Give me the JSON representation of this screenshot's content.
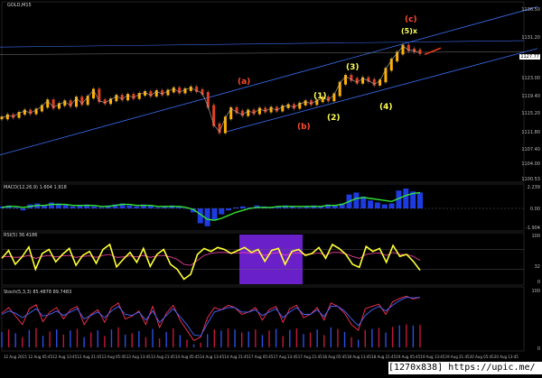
{
  "chart_data": [
    {
      "type": "line",
      "title": "GOLD,M15",
      "ylim": [
        1100.0,
        1138.0
      ],
      "tick_labels_y": [
        "1136.50",
        "1131.20",
        "1127.80",
        "1123.00",
        "1119.40",
        "1115.20",
        "1111.80",
        "1107.40",
        "1104.00",
        "1100.53"
      ],
      "current_price": "1127.77",
      "wave_labels": [
        {
          "text": "(c)",
          "color": "#ff4d2e"
        },
        {
          "text": "(5)x",
          "color": "#ffff55"
        },
        {
          "text": "(a)",
          "color": "#ff4d2e"
        },
        {
          "text": "(3)",
          "color": "#ffff55"
        },
        {
          "text": "(1)",
          "color": "#ffff55"
        },
        {
          "text": "(2)",
          "color": "#ffff55"
        },
        {
          "text": "(4)",
          "color": "#ffff55"
        },
        {
          "text": "(b)",
          "color": "#ff4d2e"
        }
      ],
      "series": [
        {
          "values": [
            1113.5,
            1114.0,
            1113.8,
            1114.5,
            1115.0,
            1114.6,
            1115.2,
            1116.0,
            1117.2,
            1115.8,
            1116.4,
            1117.0,
            1116.2,
            1117.8,
            1116.6,
            1118.0,
            1119.5,
            1117.2,
            1116.8,
            1117.4,
            1118.2,
            1117.6,
            1118.4,
            1117.9,
            1118.6,
            1119.0,
            1118.4,
            1119.2,
            1118.7,
            1119.3,
            1119.8,
            1119.1,
            1119.6,
            1120.0,
            1119.4,
            1118.8,
            1116.0,
            1112.0,
            1110.5,
            1113.5,
            1115.5,
            1114.8,
            1114.2,
            1115.0,
            1114.6,
            1115.4,
            1115.0,
            1115.6,
            1115.2,
            1115.9,
            1116.2,
            1115.8,
            1116.5,
            1117.0,
            1116.6,
            1117.2,
            1117.8,
            1117.4,
            1118.5,
            1121.0,
            1122.5,
            1121.8,
            1121.2,
            1122.0,
            1121.6,
            1120.8,
            1121.5,
            1124.0,
            1126.0,
            1127.5,
            1129.0,
            1128.2,
            1128.0,
            1127.6
          ]
        }
      ]
    },
    {
      "type": "bar",
      "title": "MACD(12,26,9) 1.604 1.918",
      "tick_labels_y": [
        "2.239",
        "0.00",
        "-1.904"
      ],
      "series": [
        {
          "values": [
            0.2,
            0.3,
            0.1,
            -0.2,
            0.4,
            0.5,
            0.3,
            0.6,
            0.5,
            0.4,
            0.2,
            0.3,
            0.4,
            0.2,
            0.1,
            0.3,
            0.4,
            0.5,
            0.3,
            0.2,
            0.4,
            0.3,
            0.1,
            0.2,
            0.3,
            0.2,
            0.0,
            -0.4,
            -1.5,
            -1.8,
            -1.2,
            -0.6,
            -0.2,
            0.1,
            0.2,
            0.1,
            0.3,
            0.2,
            0.1,
            0.2,
            0.3,
            0.2,
            0.1,
            0.2,
            0.3,
            0.2,
            0.4,
            0.3,
            0.5,
            1.4,
            1.6,
            1.2,
            0.8,
            0.6,
            0.4,
            0.5,
            1.8,
            2.0,
            1.7,
            1.6
          ]
        },
        {
          "values": [
            0.1,
            0.2,
            0.2,
            0.1,
            0.2,
            0.3,
            0.3,
            0.4,
            0.4,
            0.4,
            0.3,
            0.3,
            0.3,
            0.3,
            0.2,
            0.2,
            0.3,
            0.4,
            0.4,
            0.3,
            0.3,
            0.3,
            0.2,
            0.2,
            0.2,
            0.2,
            0.1,
            -0.1,
            -0.6,
            -1.1,
            -1.2,
            -1.0,
            -0.7,
            -0.4,
            -0.2,
            0.0,
            0.1,
            0.1,
            0.1,
            0.2,
            0.2,
            0.2,
            0.2,
            0.2,
            0.2,
            0.2,
            0.3,
            0.3,
            0.4,
            0.7,
            1.0,
            1.1,
            1.0,
            0.9,
            0.8,
            0.7,
            1.0,
            1.3,
            1.5,
            1.6
          ]
        }
      ]
    },
    {
      "type": "line",
      "title": "RSI(5) 36.4186",
      "ylim": [
        0,
        100
      ],
      "tick_labels_y": [
        "100",
        "32",
        "0"
      ],
      "series": [
        {
          "values": [
            52,
            68,
            40,
            55,
            75,
            30,
            62,
            70,
            45,
            60,
            72,
            38,
            58,
            66,
            42,
            70,
            80,
            35,
            50,
            64,
            44,
            72,
            36,
            60,
            70,
            40,
            30,
            10,
            20,
            60,
            72,
            66,
            74,
            70,
            62,
            68,
            74,
            64,
            70,
            46,
            68,
            72,
            40,
            66,
            70,
            58,
            62,
            74,
            52,
            80,
            72,
            60,
            40,
            34,
            76,
            66,
            72,
            44,
            78,
            56,
            60,
            46,
            28
          ]
        },
        {
          "values": [
            55,
            56,
            54,
            55,
            58,
            52,
            56,
            58,
            55,
            57,
            58,
            54,
            56,
            57,
            54,
            58,
            60,
            54,
            55,
            57,
            55,
            58,
            54,
            57,
            58,
            55,
            50,
            40,
            38,
            48,
            58,
            62,
            64,
            64,
            62,
            63,
            64,
            62,
            63,
            58,
            62,
            64,
            58,
            62,
            63,
            60,
            61,
            63,
            58,
            64,
            64,
            61,
            56,
            52,
            60,
            62,
            63,
            58,
            64,
            60,
            60,
            56,
            48
          ]
        }
      ]
    },
    {
      "type": "line",
      "title": "Stoch(5,3,3) 85.4878 89.7483",
      "ylim": [
        0,
        100
      ],
      "tick_labels_y": [
        "100",
        "0"
      ],
      "series": [
        {
          "values": [
            60,
            70,
            55,
            40,
            68,
            75,
            45,
            62,
            70,
            50,
            66,
            72,
            40,
            58,
            66,
            44,
            70,
            78,
            50,
            55,
            64,
            40,
            72,
            35,
            60,
            74,
            48,
            30,
            12,
            18,
            52,
            70,
            66,
            74,
            70,
            58,
            62,
            70,
            48,
            66,
            72,
            44,
            68,
            74,
            52,
            58,
            70,
            48,
            78,
            72,
            60,
            40,
            30,
            68,
            72,
            76,
            58,
            80,
            86,
            90,
            85,
            88
          ]
        },
        {
          "values": [
            58,
            64,
            60,
            52,
            60,
            68,
            55,
            58,
            64,
            56,
            62,
            68,
            50,
            56,
            62,
            52,
            64,
            72,
            58,
            56,
            62,
            48,
            64,
            44,
            56,
            68,
            54,
            40,
            22,
            20,
            42,
            62,
            66,
            70,
            70,
            62,
            62,
            66,
            56,
            62,
            68,
            52,
            62,
            70,
            58,
            58,
            66,
            54,
            72,
            72,
            64,
            50,
            38,
            56,
            66,
            72,
            64,
            74,
            82,
            88,
            87,
            88
          ]
        }
      ]
    }
  ],
  "date_labels": [
    "12 Aug 2015",
    "12 Aug 05:45",
    "12 Aug 13:45",
    "12 Aug 21:45",
    "13 Aug 05:45",
    "13 Aug 13:45",
    "13 Aug 21:45",
    "14 Aug 05:45",
    "14 Aug 13:45",
    "14 Aug 21:45",
    "17 Aug 05:45",
    "17 Aug 13:45",
    "17 Aug 21:45",
    "18 Aug 05:45",
    "18 Aug 13:45",
    "18 Aug 21:45",
    "19 Aug 05:45",
    "19 Aug 13:45",
    "19 Aug 21:45",
    "20 Aug 05:45",
    "20 Aug 13:45"
  ],
  "watermark": "[1270x838] https://upic.me/",
  "colors": {
    "background": "#000000",
    "price_line": "#b4b4b4",
    "channel": "#3a6cf0",
    "macd_hist": "#1d3be0",
    "macd_signal": "#33e633",
    "rsi_line": "#ffff33",
    "rsi_zone": "#6a20c8",
    "stoch_main": "#ff3355",
    "stoch_signal": "#4466ff"
  }
}
